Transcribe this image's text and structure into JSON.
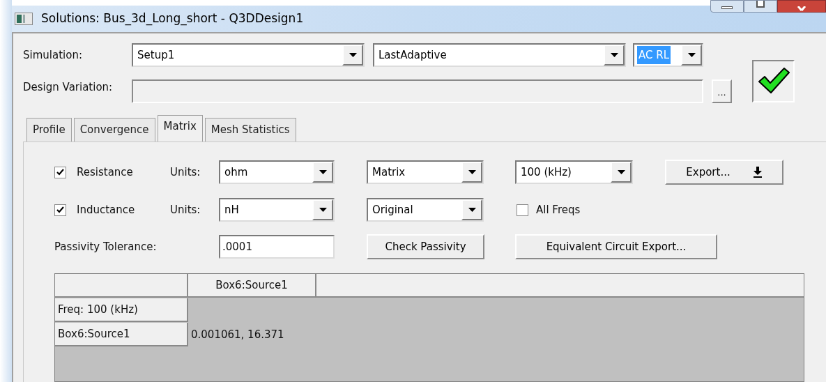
{
  "window": {
    "title": "Solutions: Bus_3d_Long_short - Q3DDesign1"
  },
  "simulation": {
    "label": "Simulation:",
    "setup": "Setup1",
    "solution": "LastAdaptive",
    "type": {
      "value": "AC RL",
      "focused": true
    }
  },
  "design_variation": {
    "label": "Design Variation:",
    "browse_button": "..."
  },
  "tabs": [
    {
      "label": "Profile",
      "selected": false
    },
    {
      "label": "Convergence",
      "selected": false
    },
    {
      "label": "Matrix",
      "selected": true
    },
    {
      "label": "Mesh Statistics",
      "selected": false
    }
  ],
  "resistance": {
    "label": "Resistance",
    "checked": true,
    "units_label": "Units:",
    "units": "ohm"
  },
  "inductance": {
    "label": "Inductance",
    "checked": true,
    "units_label": "Units:",
    "units": "nH"
  },
  "matrix_type": "Matrix",
  "view": "Original",
  "frequency": "100 (kHz)",
  "export_button": "Export...",
  "all_freqs": {
    "label": "All Freqs",
    "checked": false
  },
  "passivity": {
    "label": "Passivity Tolerance:",
    "value": ".0001",
    "check_button": "Check Passivity"
  },
  "equivalent_circuit_button": "Equivalent Circuit Export...",
  "table": {
    "columns": [
      "Box6:Source1"
    ],
    "rows": [
      {
        "header": "Freq: 100 (kHz)"
      },
      {
        "header": "Box6:Source1",
        "cells": [
          "0.001061, 16.371"
        ]
      }
    ]
  }
}
